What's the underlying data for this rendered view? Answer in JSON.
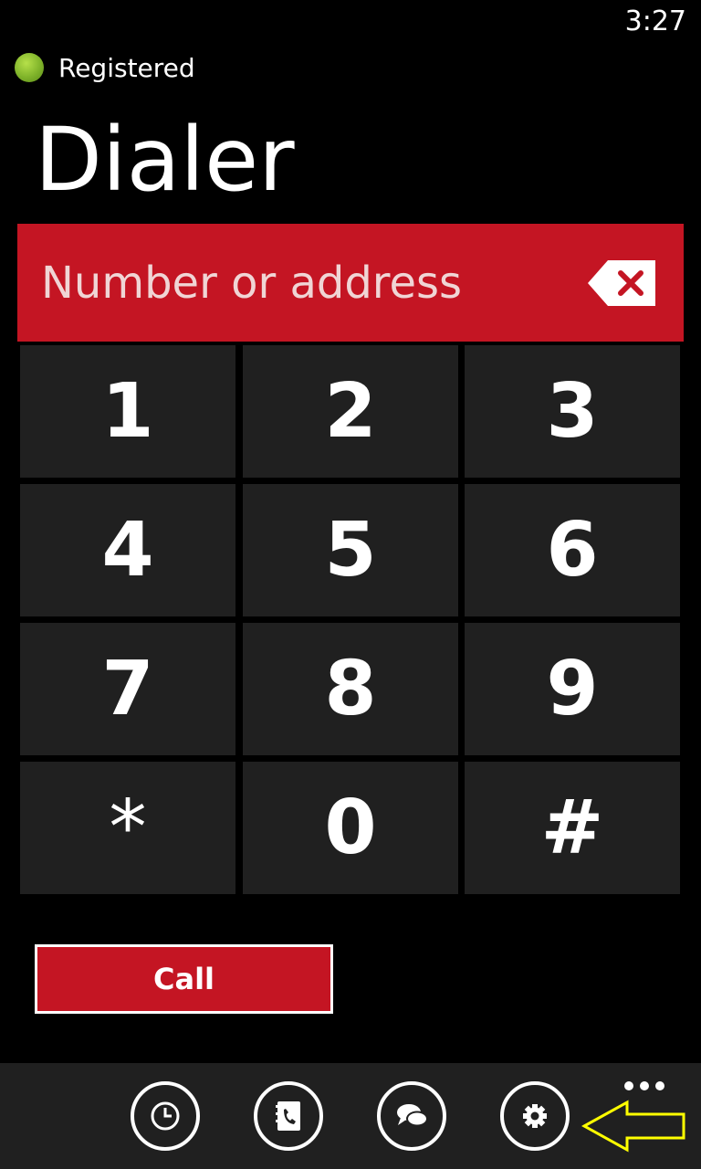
{
  "status_bar": {
    "time": "3:27"
  },
  "registration": {
    "status_label": "Registered",
    "indicator_color": "#7fb32a"
  },
  "page": {
    "title": "Dialer"
  },
  "number_input": {
    "value": "",
    "placeholder": "Number or address",
    "background": "#c41523"
  },
  "keypad": {
    "keys": [
      "1",
      "2",
      "3",
      "4",
      "5",
      "6",
      "7",
      "8",
      "9",
      "*",
      "0",
      "#"
    ]
  },
  "actions": {
    "call_label": "Call"
  },
  "app_bar": {
    "buttons": [
      "clock-icon",
      "contacts-icon",
      "chat-icon",
      "settings-icon"
    ],
    "more": "ellipsis-icon"
  },
  "annotation": {
    "arrow_color": "#ffff00"
  },
  "colors": {
    "accent": "#c41523",
    "key_bg": "#202020",
    "background": "#000000"
  }
}
